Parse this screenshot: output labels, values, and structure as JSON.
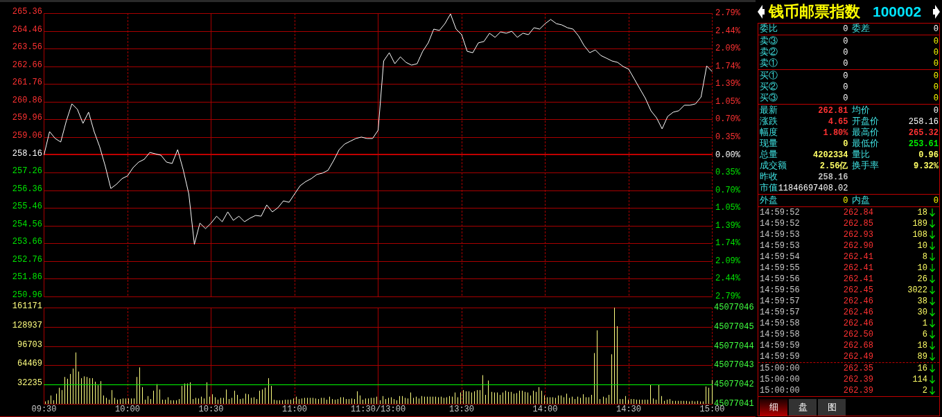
{
  "price_chart": {
    "chart_data": {
      "type": "line",
      "grid": true,
      "ylim": [
        250.96,
        265.36
      ],
      "yticks": [
        {
          "value": 265.36,
          "label": "265.36"
        },
        {
          "value": 264.46,
          "label": "264.46"
        },
        {
          "value": 263.56,
          "label": "263.56"
        },
        {
          "value": 262.66,
          "label": "262.66"
        },
        {
          "value": 261.76,
          "label": "261.76"
        },
        {
          "value": 260.86,
          "label": "260.86"
        },
        {
          "value": 259.96,
          "label": "259.96"
        },
        {
          "value": 259.06,
          "label": "259.06"
        },
        {
          "value": 258.16,
          "label": "258.16"
        },
        {
          "value": 257.26,
          "label": "257.26"
        },
        {
          "value": 256.36,
          "label": "256.36"
        },
        {
          "value": 255.46,
          "label": "255.46"
        },
        {
          "value": 254.56,
          "label": "254.56"
        },
        {
          "value": 253.66,
          "label": "253.66"
        },
        {
          "value": 252.76,
          "label": "252.76"
        },
        {
          "value": 251.86,
          "label": "251.86"
        },
        {
          "value": 250.96,
          "label": "250.96"
        }
      ],
      "ref_lines": [
        {
          "axis": "y",
          "value": 258.16
        }
      ],
      "values": [
        258.16,
        259.34,
        258.99,
        258.81,
        259.87,
        260.75,
        260.47,
        259.76,
        260.33,
        259.34,
        258.57,
        257.58,
        256.45,
        256.66,
        256.95,
        257.09,
        257.51,
        257.79,
        257.93,
        258.28,
        258.21,
        258.14,
        257.79,
        257.72,
        258.42,
        257.4,
        256.17,
        253.61,
        254.69,
        254.41,
        254.69,
        255.04,
        254.76,
        255.26,
        254.83,
        255.04,
        254.76,
        254.94,
        255.08,
        255.04,
        255.61,
        255.26,
        255.47,
        255.82,
        255.75,
        256.17,
        256.59,
        256.8,
        256.95,
        257.16,
        257.23,
        257.37,
        257.86,
        258.42,
        258.71,
        258.85,
        258.99,
        259.06,
        258.99,
        258.99,
        259.41,
        262.93,
        263.35,
        262.79,
        263.14,
        262.86,
        262.72,
        262.79,
        263.42,
        263.85,
        264.55,
        264.48,
        264.83,
        265.32,
        264.55,
        264.27,
        263.42,
        263.35,
        263.85,
        263.92,
        264.34,
        264.13,
        264.41,
        264.34,
        264.44,
        264.13,
        264.34,
        264.27,
        264.62,
        264.55,
        264.83,
        265.04,
        264.83,
        264.76,
        264.62,
        264.55,
        264.2,
        263.71,
        263.35,
        263.49,
        263.21,
        263.07,
        262.93,
        262.86,
        262.65,
        262.51,
        262.02,
        261.52,
        261.03,
        260.4,
        260.04,
        259.48,
        260.11,
        260.33,
        260.4,
        260.68,
        260.68,
        260.75,
        261.1,
        262.68,
        262.39
      ]
    },
    "right_axis": [
      "2.79%",
      "2.44%",
      "2.09%",
      "1.74%",
      "1.39%",
      "1.05%",
      "0.70%",
      "0.35%",
      "0.00%",
      "0.35%",
      "0.70%",
      "1.05%",
      "1.39%",
      "1.74%",
      "2.09%",
      "2.44%",
      "2.79%"
    ]
  },
  "volume_chart": {
    "chart_data": {
      "type": "bar",
      "grid": true,
      "ylim": [
        0,
        161171
      ],
      "yticks": [
        {
          "value": 161171,
          "label": "161171"
        },
        {
          "value": 128937,
          "label": "128937"
        },
        {
          "value": 96703,
          "label": "96703"
        },
        {
          "value": 64469,
          "label": "64469"
        },
        {
          "value": 32235,
          "label": "32235"
        }
      ],
      "ref_lines": [
        {
          "axis": "y",
          "value": 32235
        }
      ],
      "values": [
        4000,
        6000,
        14000,
        6000,
        17000,
        27000,
        23000,
        45000,
        42000,
        50000,
        59000,
        86000,
        54000,
        43000,
        46000,
        45000,
        43000,
        43000,
        37000,
        31000,
        38000,
        14000,
        10000,
        7000,
        23000,
        10000,
        7000,
        8000,
        9000,
        9000,
        9000,
        9000,
        9000,
        45000,
        61000,
        28000,
        7000,
        13000,
        8000,
        22000,
        33000,
        24000,
        7000,
        7000,
        11000,
        6000,
        6000,
        6000,
        8000,
        30000,
        34000,
        34000,
        36000,
        8000,
        10000,
        9000,
        12000,
        9000,
        36000,
        12000,
        16000,
        11000,
        7000,
        10000,
        10000,
        24000,
        8000,
        10000,
        22000,
        15000,
        8000,
        9000,
        17000,
        16000,
        10000,
        11000,
        8000,
        22000,
        24000,
        27000,
        43000,
        30000,
        7000,
        6000,
        6000,
        6000,
        7000,
        7000,
        7000,
        9000,
        12000,
        8000,
        9000,
        10000,
        10000,
        10000,
        10000,
        9000,
        8000,
        10000,
        10000,
        7000,
        12000,
        8000,
        7000,
        8000,
        11000,
        11000,
        8000,
        8000,
        9000,
        8000,
        21000,
        14000,
        7000,
        9000,
        9000,
        10000,
        10000,
        12000,
        6000,
        13000,
        8000,
        10000,
        11000,
        8000,
        6000,
        13000,
        13000,
        10000,
        9000,
        19000,
        10000,
        12000,
        9000,
        13000,
        12000,
        12000,
        12000,
        12000,
        12000,
        11000,
        12000,
        10000,
        11000,
        13000,
        12000,
        19000,
        11000,
        19000,
        23000,
        21000,
        21000,
        19000,
        21000,
        23000,
        23000,
        48000,
        15000,
        39000,
        20000,
        19000,
        19000,
        15000,
        19000,
        22000,
        20000,
        20000,
        17000,
        18000,
        22000,
        22000,
        20000,
        19000,
        14000,
        22000,
        20000,
        28000,
        22000,
        14000,
        11000,
        11000,
        11000,
        10000,
        14000,
        14000,
        11000,
        17000,
        10000,
        12000,
        8000,
        12000,
        10000,
        16000,
        11000,
        11000,
        15000,
        85000,
        123000,
        8000,
        12000,
        10000,
        15000,
        83000,
        161000,
        130000,
        8000,
        8000,
        13000,
        7000,
        8000,
        8000,
        7000,
        7000,
        7000,
        7000,
        7000,
        32000,
        9000,
        7000,
        32000,
        13000,
        5000,
        7000,
        8000,
        5000,
        5000,
        5000,
        5000,
        5000,
        5000,
        4000,
        5000,
        4000,
        5000,
        4000,
        4000,
        29000,
        27000,
        40000
      ]
    },
    "right_axis": [
      "45077046",
      "45077045",
      "45077044",
      "45077043",
      "45077042",
      "45077041"
    ]
  },
  "time_axis": [
    "09:30",
    "10:00",
    "10:30",
    "11:00",
    "11:30/13:00",
    "13:30",
    "14:00",
    "14:30",
    "15:00"
  ],
  "header": {
    "title": "钱币邮票指数",
    "code": "100002"
  },
  "order_ratio": [
    {
      "label": "委比",
      "value": "0"
    },
    {
      "label": "委差",
      "value": "0"
    }
  ],
  "asks": [
    {
      "label": "卖③",
      "price": "0",
      "volume": "0"
    },
    {
      "label": "卖②",
      "price": "0",
      "volume": "0"
    },
    {
      "label": "卖①",
      "price": "0",
      "volume": "0"
    }
  ],
  "bids": [
    {
      "label": "买①",
      "price": "0",
      "volume": "0"
    },
    {
      "label": "买②",
      "price": "0",
      "volume": "0"
    },
    {
      "label": "买③",
      "price": "0",
      "volume": "0"
    }
  ],
  "stats": [
    [
      {
        "label": "最新",
        "value": "262.81",
        "color": "#ff3232"
      },
      {
        "label": "均价",
        "value": "0"
      }
    ],
    [
      {
        "label": "涨跌",
        "value": "4.65",
        "color": "#ff3232"
      },
      {
        "label": "开盘价",
        "value": "258.16"
      }
    ],
    [
      {
        "label": "幅度",
        "value": "1.80%",
        "color": "#ff3232"
      },
      {
        "label": "最高价",
        "value": "265.32",
        "color": "#ff3232"
      }
    ],
    [
      {
        "label": "现量",
        "value": "0",
        "color": "#ffff66"
      },
      {
        "label": "最低价",
        "value": "253.61",
        "color": "#00ee00"
      }
    ],
    [
      {
        "label": "总量",
        "value": "4202334",
        "color": "#ffff66"
      },
      {
        "label": "量比",
        "value": "0.96",
        "color": "#ffff66"
      }
    ],
    [
      {
        "label": "成交额",
        "value": "2.56亿",
        "color": "#ffff66"
      },
      {
        "label": "换手率",
        "value": "9.32%",
        "color": "#ffff66"
      }
    ],
    [
      {
        "label": "昨收",
        "value": "258.16",
        "color": "#c0c0c0"
      }
    ]
  ],
  "market_value": {
    "label": "市值",
    "value": "11846697408.02"
  },
  "trade_side": [
    {
      "label": "外盘",
      "value": "0"
    },
    {
      "label": "内盘",
      "value": "0"
    }
  ],
  "tick_groups": [
    [
      {
        "time": "14:59:52",
        "price": "262.84",
        "volume": "18"
      },
      {
        "time": "14:59:52",
        "price": "262.85",
        "volume": "189"
      },
      {
        "time": "14:59:53",
        "price": "262.93",
        "volume": "108"
      },
      {
        "time": "14:59:53",
        "price": "262.90",
        "volume": "10"
      },
      {
        "time": "14:59:54",
        "price": "262.41",
        "volume": "8"
      },
      {
        "time": "14:59:55",
        "price": "262.41",
        "volume": "10"
      },
      {
        "time": "14:59:56",
        "price": "262.41",
        "volume": "26"
      },
      {
        "time": "14:59:56",
        "price": "262.45",
        "volume": "3022"
      },
      {
        "time": "14:59:57",
        "price": "262.46",
        "volume": "38"
      },
      {
        "time": "14:59:57",
        "price": "262.46",
        "volume": "30"
      },
      {
        "time": "14:59:58",
        "price": "262.46",
        "volume": "1"
      },
      {
        "time": "14:59:58",
        "price": "262.50",
        "volume": "6"
      },
      {
        "time": "14:59:59",
        "price": "262.68",
        "volume": "18"
      },
      {
        "time": "14:59:59",
        "price": "262.49",
        "volume": "89"
      }
    ],
    [
      {
        "time": "15:00:00",
        "price": "262.35",
        "volume": "16"
      },
      {
        "time": "15:00:00",
        "price": "262.39",
        "volume": "114"
      },
      {
        "time": "15:00:00",
        "price": "262.39",
        "volume": "2"
      }
    ]
  ],
  "tabs": [
    {
      "label": "细",
      "selected": true
    },
    {
      "label": "盘",
      "selected": false
    },
    {
      "label": "图",
      "selected": false
    }
  ]
}
